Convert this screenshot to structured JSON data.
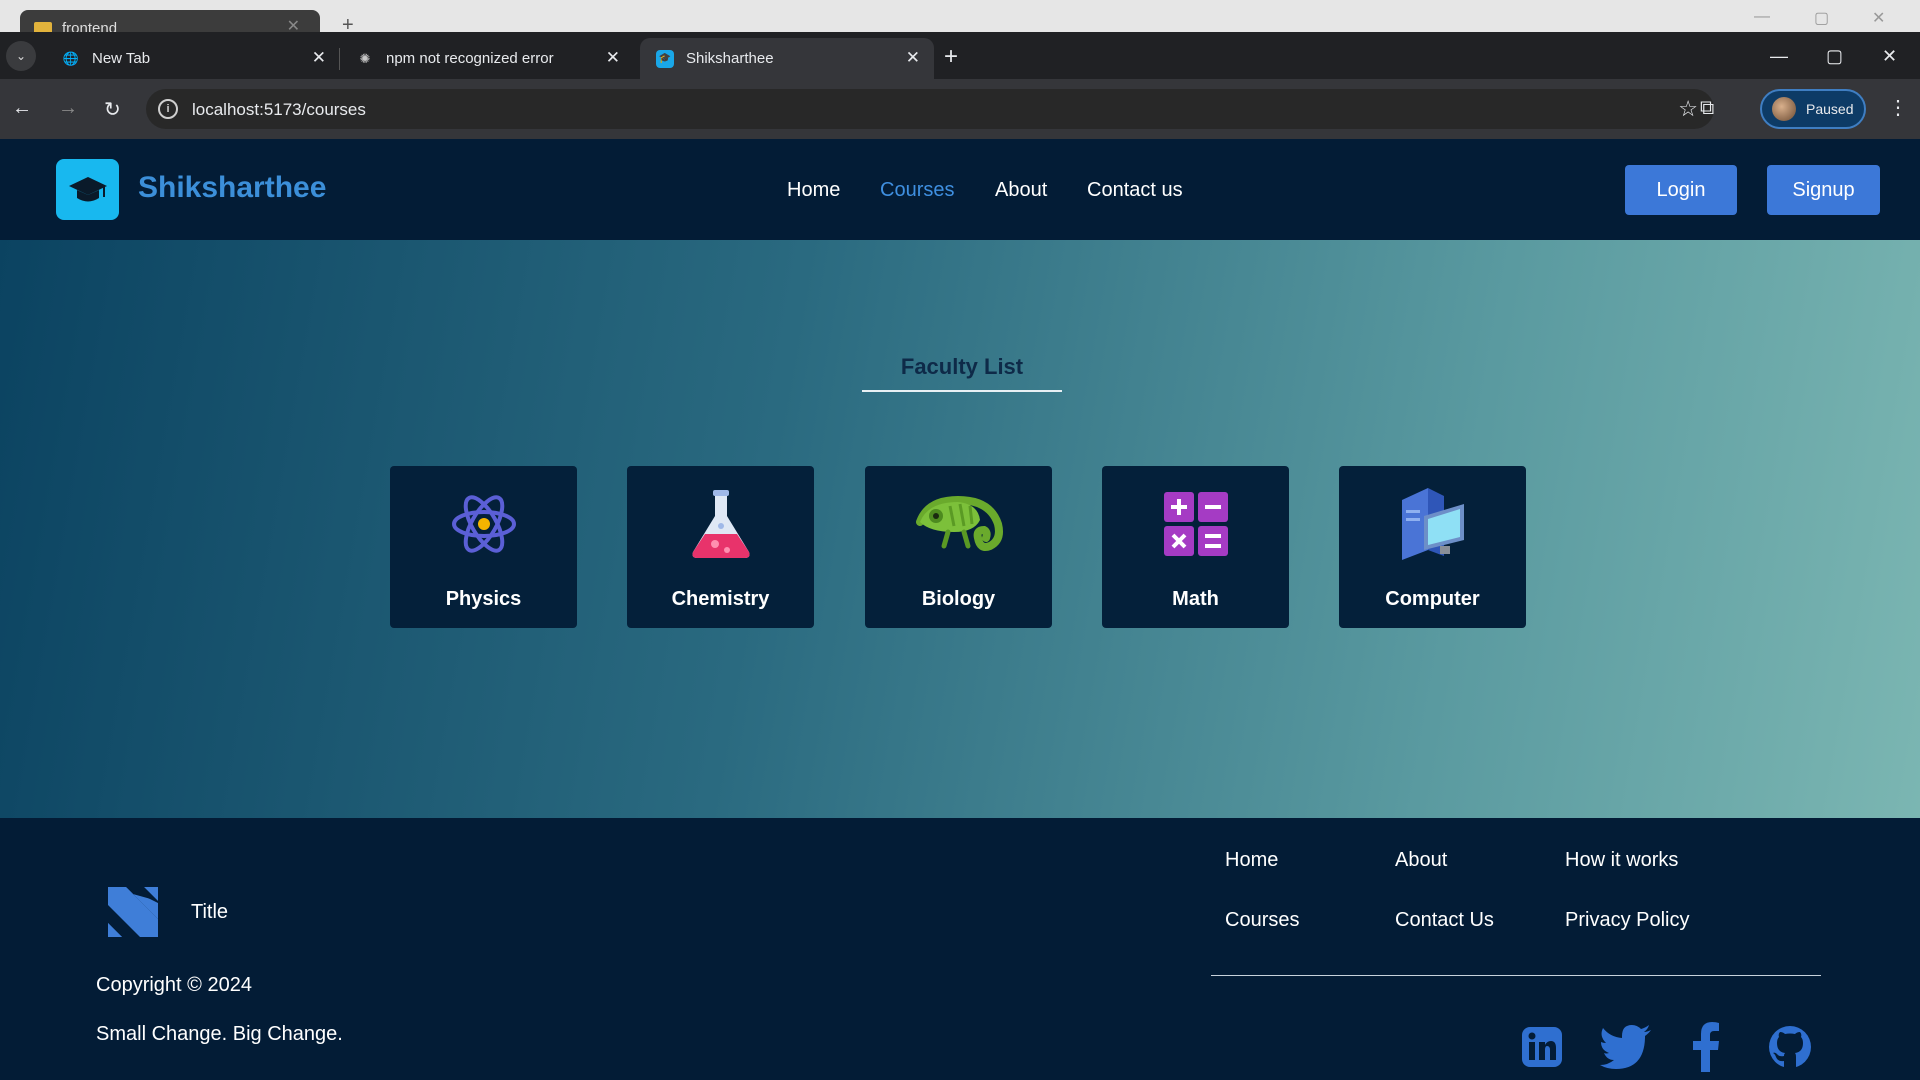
{
  "browser": {
    "background_tab": {
      "label": "frontend"
    },
    "tabs": [
      {
        "label": "New Tab"
      },
      {
        "label": "npm not recognized error"
      },
      {
        "label": "Shiksharthee"
      }
    ],
    "url": "localhost:5173/courses",
    "profile_status": "Paused"
  },
  "header": {
    "brand": "Shiksharthee",
    "nav": [
      {
        "label": "Home"
      },
      {
        "label": "Courses"
      },
      {
        "label": "About"
      },
      {
        "label": "Contact us"
      }
    ],
    "active_nav": "Courses",
    "login_label": "Login",
    "signup_label": "Signup"
  },
  "faculty": {
    "title": "Faculty List",
    "cards": [
      {
        "label": "Physics",
        "icon": "atom-icon"
      },
      {
        "label": "Chemistry",
        "icon": "flask-icon"
      },
      {
        "label": "Biology",
        "icon": "chameleon-icon"
      },
      {
        "label": "Math",
        "icon": "calculator-icon"
      },
      {
        "label": "Computer",
        "icon": "computer-icon"
      }
    ]
  },
  "footer": {
    "title": "Title",
    "copyright": "Copyright © 2024",
    "slogan": "Small Change. Big Change.",
    "links": [
      {
        "label": "Home"
      },
      {
        "label": "About"
      },
      {
        "label": "How it works"
      },
      {
        "label": "Courses"
      },
      {
        "label": "Contact Us"
      },
      {
        "label": "Privacy Policy"
      }
    ],
    "social": [
      "linkedin-icon",
      "twitter-icon",
      "facebook-icon",
      "github-icon"
    ]
  },
  "colors": {
    "header_bg": "#031c36",
    "brand": "#3c8fd9",
    "button": "#3c78d8",
    "card_bg": "#04203a",
    "social": "#2f6fd0"
  }
}
